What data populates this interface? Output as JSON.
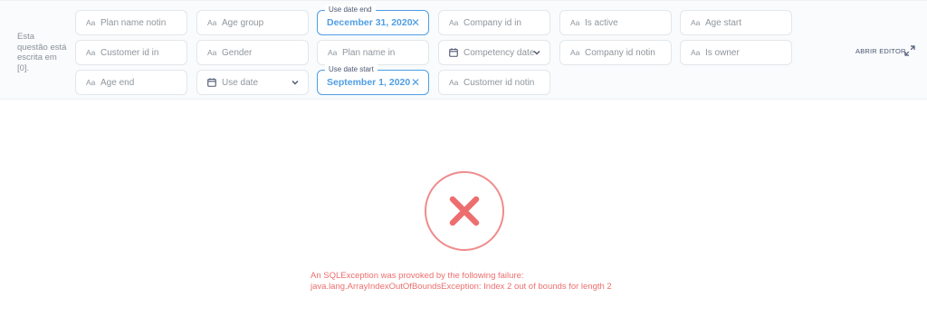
{
  "note": "Esta questão está escrita em [0].",
  "filters": {
    "plan_name_notin": "Plan name notin",
    "customer_id_in": "Customer id in",
    "age_end": "Age end",
    "age_group": "Age group",
    "gender": "Gender",
    "use_date": "Use date",
    "use_date_end": {
      "legend": "Use date end",
      "value": "December 31, 2020"
    },
    "plan_name_in": "Plan name in",
    "use_date_start": {
      "legend": "Use date start",
      "value": "September 1, 2020"
    },
    "company_id_in": "Company id in",
    "competency_date": "Competency date",
    "customer_id_notin": "Customer id notin",
    "is_active": "Is active",
    "company_id_notin": "Company id notin",
    "age_start": "Age start",
    "is_owner": "Is owner"
  },
  "text_icon": "Aa",
  "editor_button": "ABRIR EDITOR",
  "error": {
    "line1": "An SQLException was provoked by the following failure:",
    "line2": "java.lang.ArrayIndexOutOfBoundsException: Index 2 out of bounds for length 2"
  },
  "colors": {
    "accent": "#509ee3",
    "error": "#ed6e6e",
    "error_ring": "#ef8c8c"
  },
  "icons": [
    "text-type-icon",
    "calendar-icon",
    "chevron-down-icon",
    "clear-icon",
    "expand-icon",
    "error-x-icon"
  ]
}
